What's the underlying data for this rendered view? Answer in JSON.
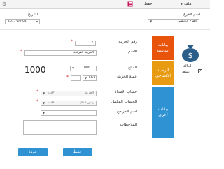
{
  "toolbar": {
    "menu_label": "ملف",
    "save_label": "حفظ"
  },
  "header": {
    "branch_label": "اسم الفرع",
    "branch_value": "الفرع الرئيسي",
    "date_label": "التاريخ",
    "date_value": "2017-10-04"
  },
  "tabs": {
    "basic": "بيانات أساسية",
    "balance": "الرصيد الافتتاحي",
    "other": "بيانات أخرى"
  },
  "side": {
    "active_label": "الحالة",
    "active_checkbox_label": "نشط",
    "active_checked": true
  },
  "form": {
    "box_number_label": "رقم الخزينة",
    "box_number_value": "2",
    "name_label": "الاسم",
    "name_value": "الخزينة الفرعية",
    "amount_label": "المبلغ",
    "amount_value": "1000",
    "currency_label": "عملة الخزينة",
    "currency_value": "EGP",
    "rate_value": "1",
    "big_amount": "1000",
    "account_label": "حساب الأستاذ",
    "account_value": "الخزينة",
    "account_currency": "EGP",
    "complement_label": "الحساب المكمل",
    "complement_value": "رأس المال",
    "complement_currency": "EGP",
    "reviewer_label": "اسم المراجع",
    "reviewer_value": "",
    "notes_label": "الملاحظات",
    "notes_value": ""
  },
  "buttons": {
    "save": "حفظ",
    "back": "عودة"
  },
  "colors": {
    "basic_tab": "#e8540c",
    "balance_tab": "#e89a12",
    "other_tab": "#2f93d3",
    "button": "#2f93d3",
    "required": "#d32f2f"
  }
}
